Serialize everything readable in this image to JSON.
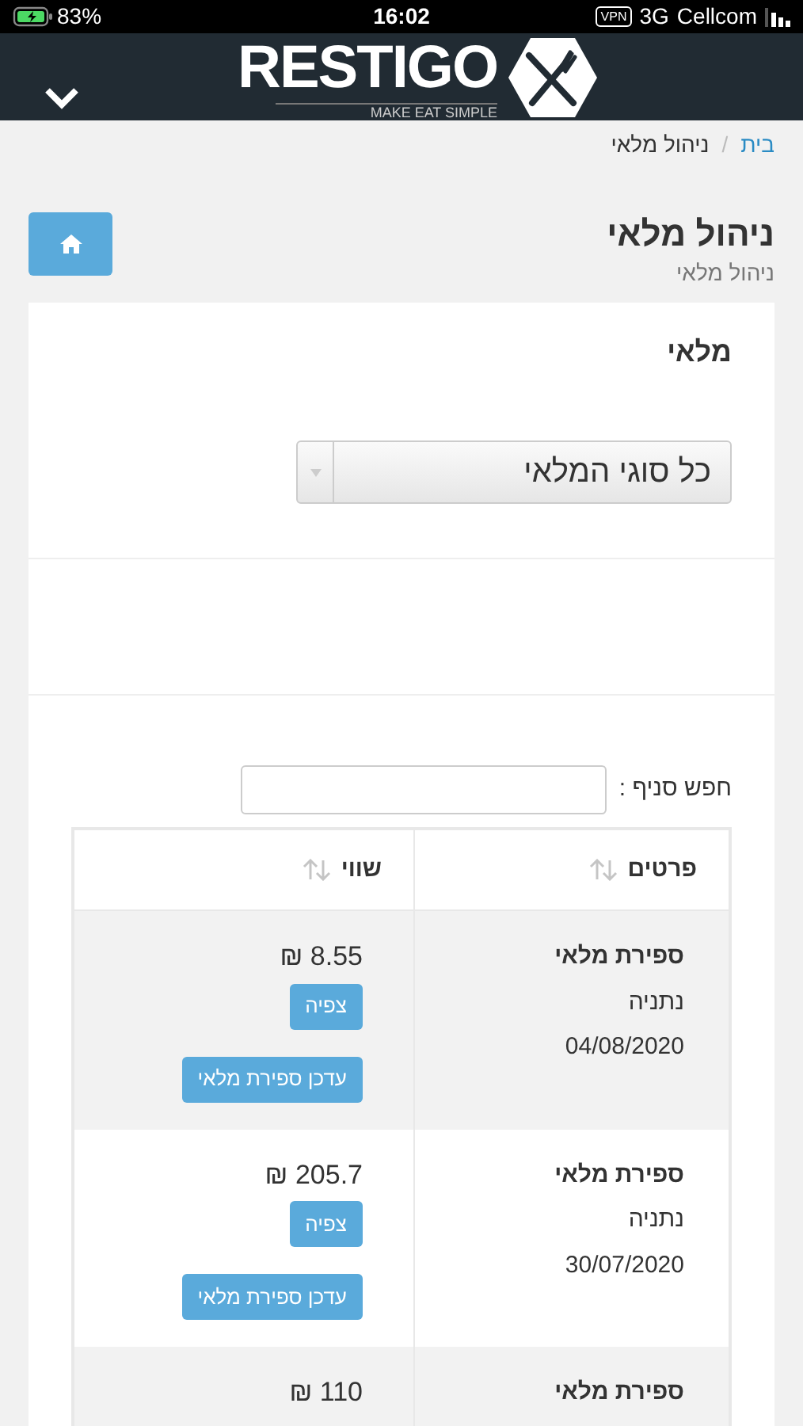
{
  "status_bar": {
    "battery": "83%",
    "time": "16:02",
    "vpn": "VPN",
    "network": "3G",
    "carrier": "Cellcom"
  },
  "header": {
    "logo_text": "RESTIGO",
    "tagline": "MAKE EAT SIMPLE"
  },
  "breadcrumb": [
    {
      "label": "בית",
      "kind": "link"
    },
    {
      "label": "/",
      "kind": "separator"
    },
    {
      "label": "ניהול מלאי",
      "kind": "current"
    }
  ],
  "page": {
    "title": "ניהול מלאי",
    "subtitle": "ניהול מלאי"
  },
  "card": {
    "title": "מלאי",
    "select": {
      "value": "כל סוגי המלאי"
    }
  },
  "search": {
    "label": "חפש סניף :"
  },
  "table": {
    "columns": [
      "פרטים",
      "שווי"
    ],
    "rows": [
      {
        "title": "ספירת מלאי",
        "branch": "נתניה",
        "date": "04/08/2020",
        "value": "8.55 ₪",
        "view_button": "צפיה",
        "update_button": "עדכן ספירת מלאי"
      },
      {
        "title": "ספירת מלאי",
        "branch": "נתניה",
        "date": "30/07/2020",
        "value": "205.7 ₪",
        "view_button": "צפיה",
        "update_button": "עדכן ספירת מלאי"
      },
      {
        "title": "ספירת מלאי",
        "value": "110 ₪"
      }
    ]
  }
}
